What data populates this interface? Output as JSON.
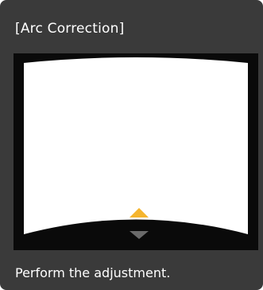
{
  "dialog": {
    "title": "[Arc Correction]",
    "message": "Perform the adjustment."
  },
  "preview": {
    "frame_color": "#0a0a0a",
    "image_color": "#ffffff",
    "active_arrow": {
      "icon": "triangle-up-icon",
      "color": "#f5b52e"
    },
    "inactive_arrow": {
      "icon": "triangle-down-icon",
      "color": "#6a6a6a"
    }
  },
  "colors": {
    "background": "#3a3a3a",
    "text": "#ffffff"
  }
}
